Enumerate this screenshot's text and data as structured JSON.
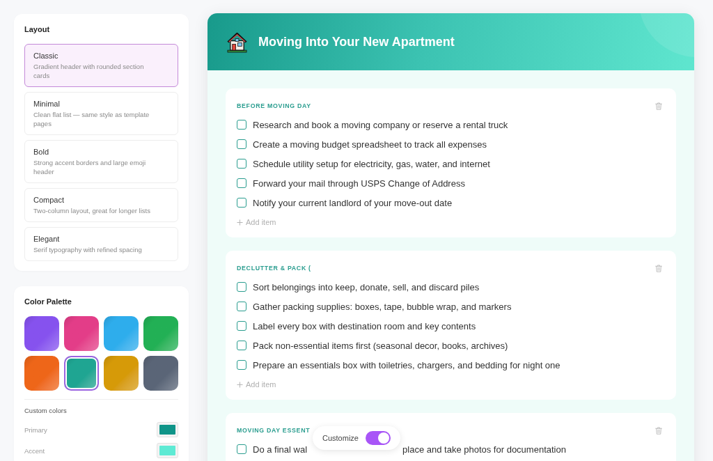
{
  "sidebar": {
    "layout": {
      "title": "Layout",
      "options": [
        {
          "name": "Classic",
          "description": "Gradient header with rounded section cards",
          "selected": true
        },
        {
          "name": "Minimal",
          "description": "Clean flat list — same style as template pages",
          "selected": false
        },
        {
          "name": "Bold",
          "description": "Strong accent borders and large emoji header",
          "selected": false
        },
        {
          "name": "Compact",
          "description": "Two-column layout, great for longer lists",
          "selected": false
        },
        {
          "name": "Elegant",
          "description": "Serif typography with refined spacing",
          "selected": false
        }
      ]
    },
    "color_palette": {
      "title": "Color Palette",
      "swatches": [
        {
          "color": "#8652ee",
          "selected": false
        },
        {
          "color": "#e33d88",
          "selected": false
        },
        {
          "color": "#2eadec",
          "selected": false
        },
        {
          "color": "#22b055",
          "selected": false
        },
        {
          "color": "#ee6619",
          "selected": false
        },
        {
          "color": "#1fa592",
          "selected": true
        },
        {
          "color": "#d69a08",
          "selected": false
        },
        {
          "color": "#5a6577",
          "selected": false
        }
      ],
      "custom_colors": {
        "title": "Custom colors",
        "items": [
          {
            "label": "Primary",
            "color": "#0f9488"
          },
          {
            "label": "Accent",
            "color": "#5eead4"
          }
        ]
      }
    }
  },
  "checklist": {
    "title": "Moving Into Your New Apartment",
    "sections": [
      {
        "title": "BEFORE MOVING DAY",
        "items": [
          {
            "text": [
              "Research and book a moving company or reserve a rental truck"
            ],
            "checked": false
          },
          {
            "text": [
              "Create a moving budget spreadsheet to track all expenses"
            ],
            "checked": false
          },
          {
            "text": [
              "Schedule utility setup for electricity, gas, water, and internet"
            ],
            "checked": false
          },
          {
            "text": [
              "Forward your mail through USPS Change of Address"
            ],
            "checked": false
          },
          {
            "text": [
              "Notify your current landlord of your move-out date"
            ],
            "checked": false
          }
        ],
        "add_label": "Add item"
      },
      {
        "title": "DECLUTTER & PACK (",
        "items": [
          {
            "text": [
              "Sort belongings into keep, donate, sell, and discard piles"
            ],
            "checked": false
          },
          {
            "text": [
              "Gather packing supplies: boxes, tape, bubble wrap, and markers"
            ],
            "checked": false
          },
          {
            "text": [
              "Label every box with destination room and key contents"
            ],
            "checked": false
          },
          {
            "text": [
              "Pack non-essential items first (seasonal decor, books, archives)"
            ],
            "checked": false
          },
          {
            "text": [
              "Prepare an essentials box with toiletries, chargers, and bedding for night one"
            ],
            "checked": false
          }
        ],
        "add_label": "Add item"
      },
      {
        "title": "MOVING DAY ESSENT",
        "items": [
          {
            "text": [
              "Do a final wal",
              "place and take photos for documentation"
            ],
            "checked": false
          }
        ]
      }
    ]
  },
  "customize": {
    "label": "Customize",
    "on": true
  }
}
